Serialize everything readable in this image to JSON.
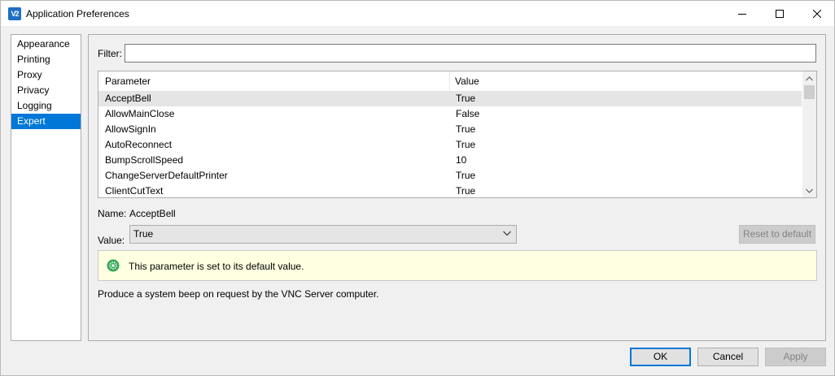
{
  "window": {
    "title": "Application Preferences",
    "app_icon_text": "V2",
    "icons": {
      "app": "vnc-viewer-icon",
      "minimize": "minimize-icon",
      "maximize": "maximize-icon",
      "close": "close-icon"
    }
  },
  "sidebar": {
    "items": [
      {
        "label": "Appearance",
        "selected": false
      },
      {
        "label": "Printing",
        "selected": false
      },
      {
        "label": "Proxy",
        "selected": false
      },
      {
        "label": "Privacy",
        "selected": false
      },
      {
        "label": "Logging",
        "selected": false
      },
      {
        "label": "Expert",
        "selected": true
      }
    ]
  },
  "filter": {
    "label": "Filter:",
    "value": ""
  },
  "table": {
    "columns": [
      "Parameter",
      "Value"
    ],
    "rows": [
      {
        "parameter": "AcceptBell",
        "value": "True",
        "selected": true
      },
      {
        "parameter": "AllowMainClose",
        "value": "False",
        "selected": false
      },
      {
        "parameter": "AllowSignIn",
        "value": "True",
        "selected": false
      },
      {
        "parameter": "AutoReconnect",
        "value": "True",
        "selected": false
      },
      {
        "parameter": "BumpScrollSpeed",
        "value": "10",
        "selected": false
      },
      {
        "parameter": "ChangeServerDefaultPrinter",
        "value": "True",
        "selected": false
      },
      {
        "parameter": "ClientCutText",
        "value": "True",
        "selected": false
      }
    ]
  },
  "detail": {
    "name_label": "Name:",
    "name_value": "AcceptBell",
    "value_label": "Value:",
    "value_selected": "True",
    "reset_label": "Reset to default",
    "info_text": "This parameter is set to its default value.",
    "description": "Produce a system beep on request by the VNC Server computer."
  },
  "footer": {
    "ok_label": "OK",
    "cancel_label": "Cancel",
    "apply_label": "Apply"
  },
  "colors": {
    "accent": "#0078d7",
    "info_background": "#ffffe1",
    "success_icon": "#34a853"
  }
}
